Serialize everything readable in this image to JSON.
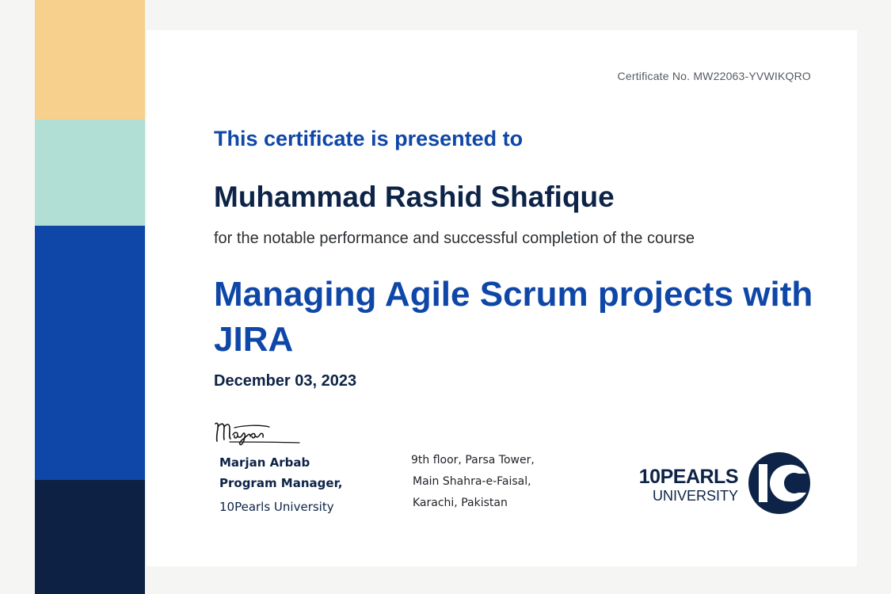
{
  "colors": {
    "stripe_1": "#f6d08c",
    "stripe_2": "#b1ded5",
    "stripe_3": "#0e47a8",
    "stripe_4": "#0d2145",
    "primary_blue": "#0f47a8",
    "navy": "#0d2347"
  },
  "certificate": {
    "number": "Certificate No. MW22063-YVWIKQRO",
    "presented_to": "This certificate is presented to",
    "recipient": "Muhammad Rashid Shafique",
    "completion_text": "for the notable performance and successful completion of the course",
    "course_title": "Managing Agile Scrum projects with JIRA",
    "date": "December 03, 2023"
  },
  "signer": {
    "signature": "Marjan",
    "name": "Marjan Arbab",
    "title": "Program Manager,",
    "organization": "10Pearls University"
  },
  "address": {
    "line_1": "9th floor, Parsa Tower,",
    "line_2": "Main Shahra-e-Faisal,",
    "line_3": "Karachi, Pakistan"
  },
  "logo": {
    "line_1": "10PEARLS",
    "line_2": "UNIVERSITY",
    "mark": "10"
  }
}
